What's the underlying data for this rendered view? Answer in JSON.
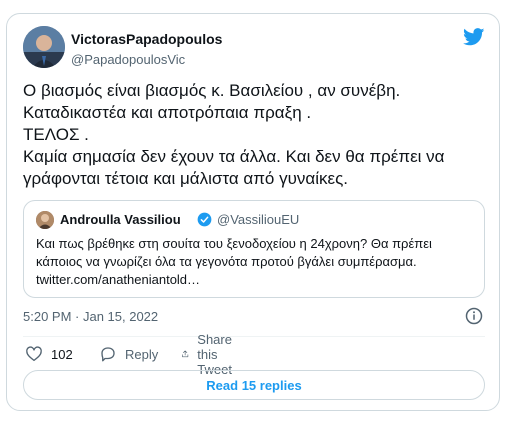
{
  "tweet": {
    "display_name": "VictorasPapadopoulos",
    "handle": "@PapadopoulosVic",
    "text": "Ο βιασμός είναι βιασμός κ. Βασιλείου , αν συνέβη.\nΚαταδικαστέα και αποτρόπαια πραξη .\nΤΕΛΟΣ .\nΚαμία σημασία δεν έχουν τα άλλα. Και δεν θα πρέπει να\nγράφονται τέτοια και μάλιστα από γυναίκες.",
    "timestamp": "5:20 PM · Jan 15, 2022"
  },
  "quoted": {
    "display_name": "Androulla Vassiliou",
    "handle": "@VassiliouEU",
    "text": "Και πως βρέθηκε στη σουίτα του ξενοδοχείου η 24χρονη? Θα πρέπει\nκάποιος να γνωρίζει όλα τα γεγονότα προτού βγάλει συμπέρασμα.\ntwitter.com/anatheniantold…"
  },
  "actions": {
    "like_count": "102",
    "reply_label": "Reply",
    "share_label": "Share this Tweet"
  },
  "read_replies_label": "Read 15 replies",
  "colors": {
    "accent": "#1d9bf0",
    "text": "#0f1419",
    "secondary": "#536471",
    "border": "#cfd9de"
  },
  "icons": [
    "twitter-bird-icon",
    "verified-badge-icon",
    "info-icon",
    "heart-icon",
    "reply-icon",
    "share-icon"
  ]
}
